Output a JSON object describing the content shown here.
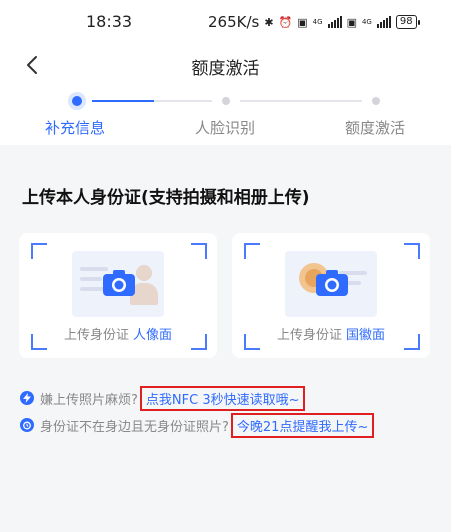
{
  "status_bar": {
    "time": "18:33",
    "speed": "265K/s",
    "net1": "4G",
    "net2": "4G",
    "battery": "98"
  },
  "nav": {
    "title": "额度激活"
  },
  "steps": [
    {
      "label": "补充信息",
      "state": "active"
    },
    {
      "label": "人脸识别",
      "state": "pending"
    },
    {
      "label": "额度激活",
      "state": "pending"
    }
  ],
  "upload": {
    "title": "上传本人身份证(支持拍摄和相册上传)",
    "front": {
      "caption": "上传身份证",
      "side": "人像面"
    },
    "back": {
      "caption": "上传身份证",
      "side": "国徽面"
    }
  },
  "tips": [
    {
      "text": "嫌上传照片麻烦?",
      "link": "点我NFC 3秒快速读取哦~",
      "icon": "lightning-icon"
    },
    {
      "text": "身份证不在身边且无身份证照片?",
      "link": "今晚21点提醒我上传~",
      "icon": "alarm-icon"
    }
  ],
  "colors": {
    "accent": "#2f6bff",
    "highlight_box": "#e02020"
  }
}
